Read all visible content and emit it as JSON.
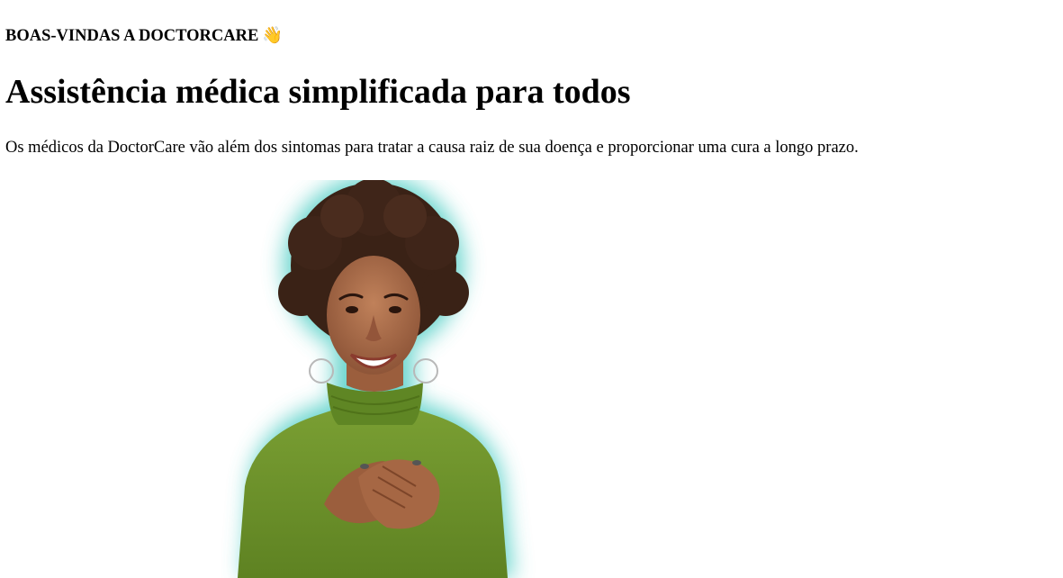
{
  "hero": {
    "eyebrow": "BOAS-VINDAS A DOCTORCARE",
    "eyebrow_emoji": "👋",
    "title": "Assistência médica simplificada para todos",
    "description": "Os médicos da DoctorCare vão além dos sintomas para tratar a causa raiz de sua doença e proporcionar uma cura a longo prazo."
  },
  "image": {
    "glow_color": "#4ecdc4",
    "sweater_color": "#6b8f2a",
    "hair_color": "#3a2216",
    "skin_color": "#a86a48"
  }
}
